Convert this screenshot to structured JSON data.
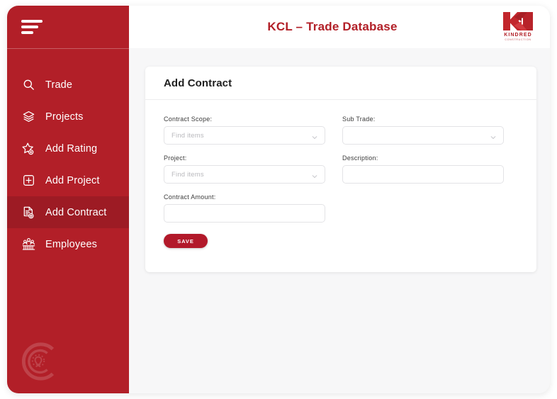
{
  "app": {
    "header": {
      "title": "KCL – Trade Database",
      "logo": {
        "name": "KINDRED",
        "subtitle": "CONSTRUCTION",
        "icon": "kindred-kc-logo"
      },
      "menu_icon": "hamburger-menu-icon"
    },
    "sidebar": {
      "active_item": "Add Contract",
      "items": [
        {
          "label": "Trade",
          "icon": "search-icon",
          "active": false
        },
        {
          "label": "Projects",
          "icon": "layers-icon",
          "active": false
        },
        {
          "label": "Add Rating",
          "icon": "star-plus-icon",
          "active": false
        },
        {
          "label": "Add Project",
          "icon": "plus-square-icon",
          "active": false
        },
        {
          "label": "Add Contract",
          "icon": "document-plus-icon",
          "active": true
        },
        {
          "label": "Employees",
          "icon": "people-group-icon",
          "active": false
        }
      ],
      "watermark_icon": "c-lightbulb-watermark-icon"
    },
    "card": {
      "title": "Add Contract",
      "fields": {
        "contract_scope": {
          "label": "Contract Scope:",
          "placeholder": "Find items",
          "value": "",
          "type": "select-search"
        },
        "sub_trade": {
          "label": "Sub Trade:",
          "placeholder": "",
          "value": "",
          "type": "select"
        },
        "project": {
          "label": "Project:",
          "placeholder": "Find items",
          "value": "",
          "type": "select-search"
        },
        "description": {
          "label": "Description:",
          "placeholder": "",
          "value": "",
          "type": "text"
        },
        "contract_amount": {
          "label": "Contract Amount:",
          "placeholder": "",
          "value": "",
          "type": "text"
        }
      },
      "save_label": "SAVE"
    },
    "colors": {
      "sidebar_red": "#b21f28",
      "sidebar_active_red": "#9d1b24",
      "brand_red": "#b22028",
      "button_red": "#b2192a",
      "page_bg": "#f7f7f8",
      "card_bg": "#ffffff"
    }
  }
}
